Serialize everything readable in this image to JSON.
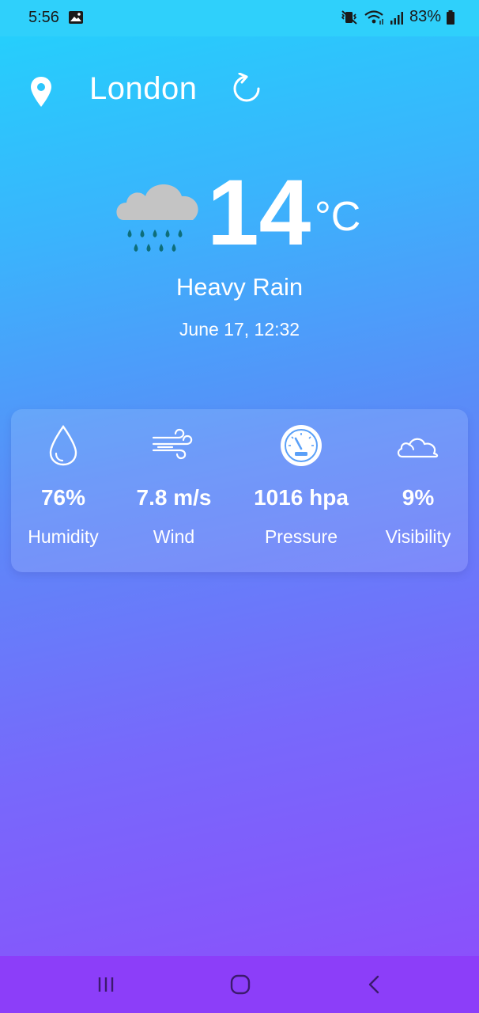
{
  "status_bar": {
    "time": "5:56",
    "battery": "83%",
    "icons": [
      "gallery-notification-icon",
      "mute-vibrate-icon",
      "wifi-icon",
      "signal-icon",
      "battery-icon"
    ]
  },
  "header": {
    "city": "London",
    "icons": [
      "location-pin-icon",
      "refresh-icon"
    ]
  },
  "current": {
    "temperature": "14",
    "unit": "°C",
    "condition": "Heavy Rain",
    "datetime": "June 17, 12:32",
    "icon": "heavy-rain-cloud-icon"
  },
  "details": [
    {
      "value": "76%",
      "label": "Humidity",
      "icon": "droplet-icon"
    },
    {
      "value": "7.8 m/s",
      "label": "Wind",
      "icon": "wind-icon"
    },
    {
      "value": "1016 hpa",
      "label": "Pressure",
      "icon": "gauge-icon"
    },
    {
      "value": "9%",
      "label": "Visibility",
      "icon": "cloud-outline-icon"
    }
  ],
  "nav_bar": {
    "buttons": [
      "recent-apps-icon",
      "home-icon",
      "back-icon"
    ]
  },
  "colors": {
    "gradient_top": "#22d3fc",
    "gradient_bottom": "#8e4cfb",
    "rain_drop": "#0e6e7a",
    "cloud": "#c4c4c4",
    "navbar": "#8c3ef9"
  }
}
